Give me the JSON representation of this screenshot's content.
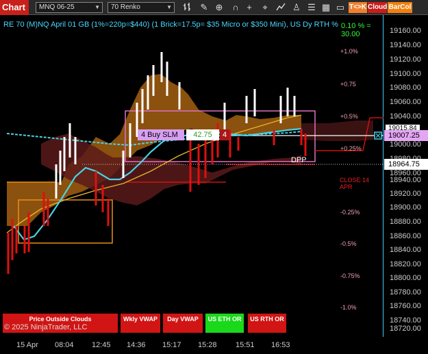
{
  "toolbar": {
    "chart_tab": "Chart",
    "instrument": "MNQ 06-25",
    "bar_type": "70 Renko",
    "icons": [
      "bar-style-icon",
      "pencil-icon",
      "zoom-icon",
      "magnet-icon",
      "crosshair-icon",
      "global-crosshair-icon",
      "indicators-icon",
      "strategies-icon",
      "properties-icon",
      "layout-icon",
      "data-box-icon"
    ],
    "btn_tk": "T<>K",
    "btn_cloud": "Cloud",
    "btn_barcol": "BarCol"
  },
  "chart": {
    "title": "RE 70 (M)NQ April 01 GB (1%=220p=$440) (1 Brick=17.5p= $35 Micro or $350 Mini), US Dy RTH %",
    "green_value": "0.10 % = 30.00",
    "pct_labels": [
      "+1.0%",
      "+0.75",
      "+0.5%",
      "+0.25%",
      "-0.25%",
      "-0.5%",
      "-0.75%",
      "-1.0%"
    ],
    "close_label": "CLOSE 14 APR",
    "dpp_label": "DPP",
    "order": {
      "label": "4 Buy SLM",
      "price": "42.75",
      "qty": "4"
    },
    "colors": {
      "up_brick": "#ffffff",
      "down_brick": "#e01010",
      "cloud": "#b06a10",
      "vwap": "#49d3e6",
      "ma": "#e5b52a",
      "box": "#e070c0"
    }
  },
  "price_axis": {
    "ticks": [
      "19160.00",
      "19140.00",
      "19120.00",
      "19100.00",
      "19080.00",
      "19060.00",
      "19040.00",
      "19015.84",
      "19000.00",
      "18980.00",
      "18960.00",
      "18940.00",
      "18920.00",
      "18900.00",
      "18880.00",
      "18860.00",
      "18840.00",
      "18820.00",
      "18800.00",
      "18780.00",
      "18760.00",
      "18740.00",
      "18720.00"
    ],
    "tag_current": "19007.25",
    "tag_white": "18964.75"
  },
  "time_axis": {
    "ticks": [
      "15 Apr",
      "08:04",
      "12:45",
      "14:36",
      "15:17",
      "15:28",
      "15:51",
      "16:53"
    ]
  },
  "indicators": {
    "price_outside_clouds": "Price Outside Clouds",
    "wkly_vwap": "Wkly VWAP",
    "day_vwap": "Day VWAP",
    "us_eth_or": "US ETH OR",
    "us_rth_or": "US RTH OR"
  },
  "copyright": "© 2025 NinjaTrader, LLC"
}
